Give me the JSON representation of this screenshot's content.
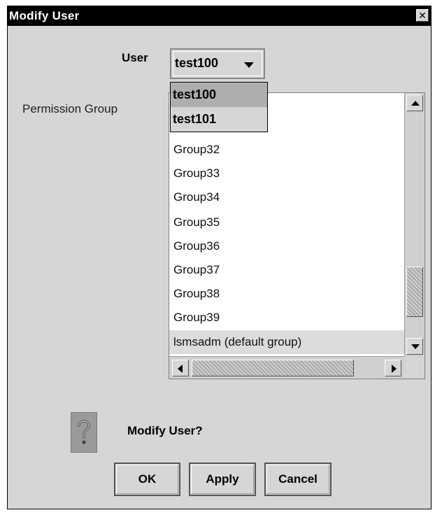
{
  "window": {
    "title": "Modify User",
    "close_glyph": "✕"
  },
  "user": {
    "label": "User",
    "selected": "test100"
  },
  "permission": {
    "label": "Permission Group",
    "items": [
      "Group32",
      "Group33",
      "Group34",
      "Group35",
      "Group36",
      "Group37",
      "Group38",
      "Group39",
      "lsmsadm (default group)"
    ]
  },
  "popup": {
    "options": [
      "test100",
      "test101"
    ],
    "highlighted": "test100"
  },
  "confirm": {
    "icon": "question-icon",
    "text": "Modify User?"
  },
  "buttons": {
    "ok": "OK",
    "apply": "Apply",
    "cancel": "Cancel"
  }
}
